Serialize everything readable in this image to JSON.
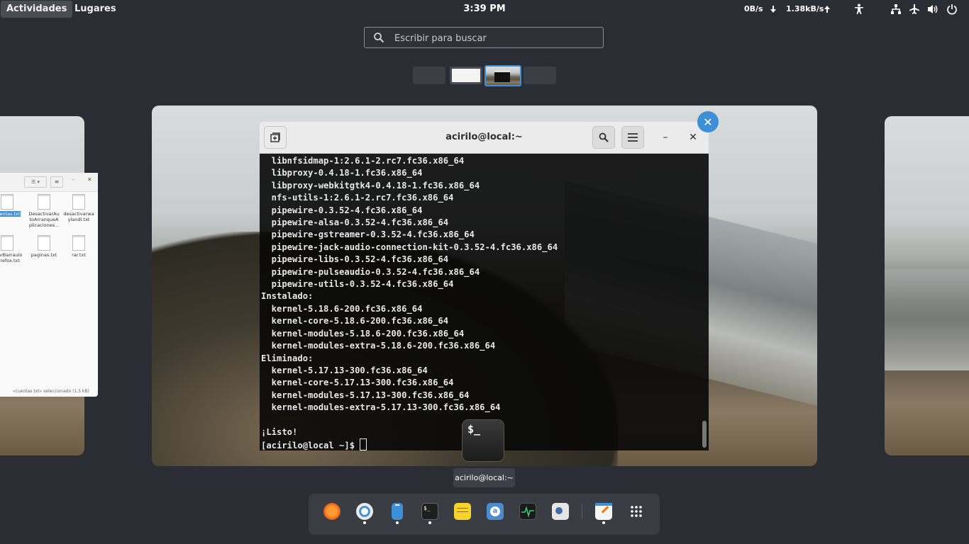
{
  "topbar": {
    "activities": "Actividades",
    "places": "Lugares",
    "clock": "3:39 PM",
    "net_down": "0B/s",
    "net_up": "1.38kB/s",
    "icons": [
      "arrow-down-icon",
      "arrow-up-icon",
      "accessibility-icon",
      "network-icon",
      "airplane-icon",
      "volume-icon",
      "power-icon"
    ]
  },
  "search": {
    "placeholder": "Escribir para buscar"
  },
  "terminal": {
    "title": "acirilo@local:~",
    "lines": [
      "  libnfsidmap-1:2.6.1-2.rc7.fc36.x86_64",
      "  libproxy-0.4.18-1.fc36.x86_64",
      "  libproxy-webkitgtk4-0.4.18-1.fc36.x86_64",
      "  nfs-utils-1:2.6.1-2.rc7.fc36.x86_64",
      "  pipewire-0.3.52-4.fc36.x86_64",
      "  pipewire-alsa-0.3.52-4.fc36.x86_64",
      "  pipewire-gstreamer-0.3.52-4.fc36.x86_64",
      "  pipewire-jack-audio-connection-kit-0.3.52-4.fc36.x86_64",
      "  pipewire-libs-0.3.52-4.fc36.x86_64",
      "  pipewire-pulseaudio-0.3.52-4.fc36.x86_64",
      "  pipewire-utils-0.3.52-4.fc36.x86_64",
      "Instalado:",
      "  kernel-5.18.6-200.fc36.x86_64",
      "  kernel-core-5.18.6-200.fc36.x86_64",
      "  kernel-modules-5.18.6-200.fc36.x86_64",
      "  kernel-modules-extra-5.18.6-200.fc36.x86_64",
      "Eliminado:",
      "  kernel-5.17.13-300.fc36.x86_64",
      "  kernel-core-5.17.13-300.fc36.x86_64",
      "  kernel-modules-5.17.13-300.fc36.x86_64",
      "  kernel-modules-extra-5.17.13-300.fc36.x86_64",
      "",
      "¡Listo!"
    ],
    "prompt": "[acirilo@local ~]$ "
  },
  "tooltip": "acirilo@local:~",
  "file_manager": {
    "files": [
      "cuentas.txt",
      "DesactivarAutoArranqueAplicaciones...",
      "desactivarwaylandl.txt",
      "ultarBarraulosFirefox.txt",
      "paginas.txt",
      "rar.txt"
    ],
    "status": "«cuentas.txt» seleccionado  (1.5 kB)"
  },
  "dock": {
    "apps": [
      "firefox-icon",
      "chromium-icon",
      "files-icon",
      "terminal-icon",
      "notes-icon",
      "app-store-icon",
      "system-monitor-icon",
      "settings-icon",
      "text-editor-icon",
      "app-grid-icon"
    ]
  }
}
